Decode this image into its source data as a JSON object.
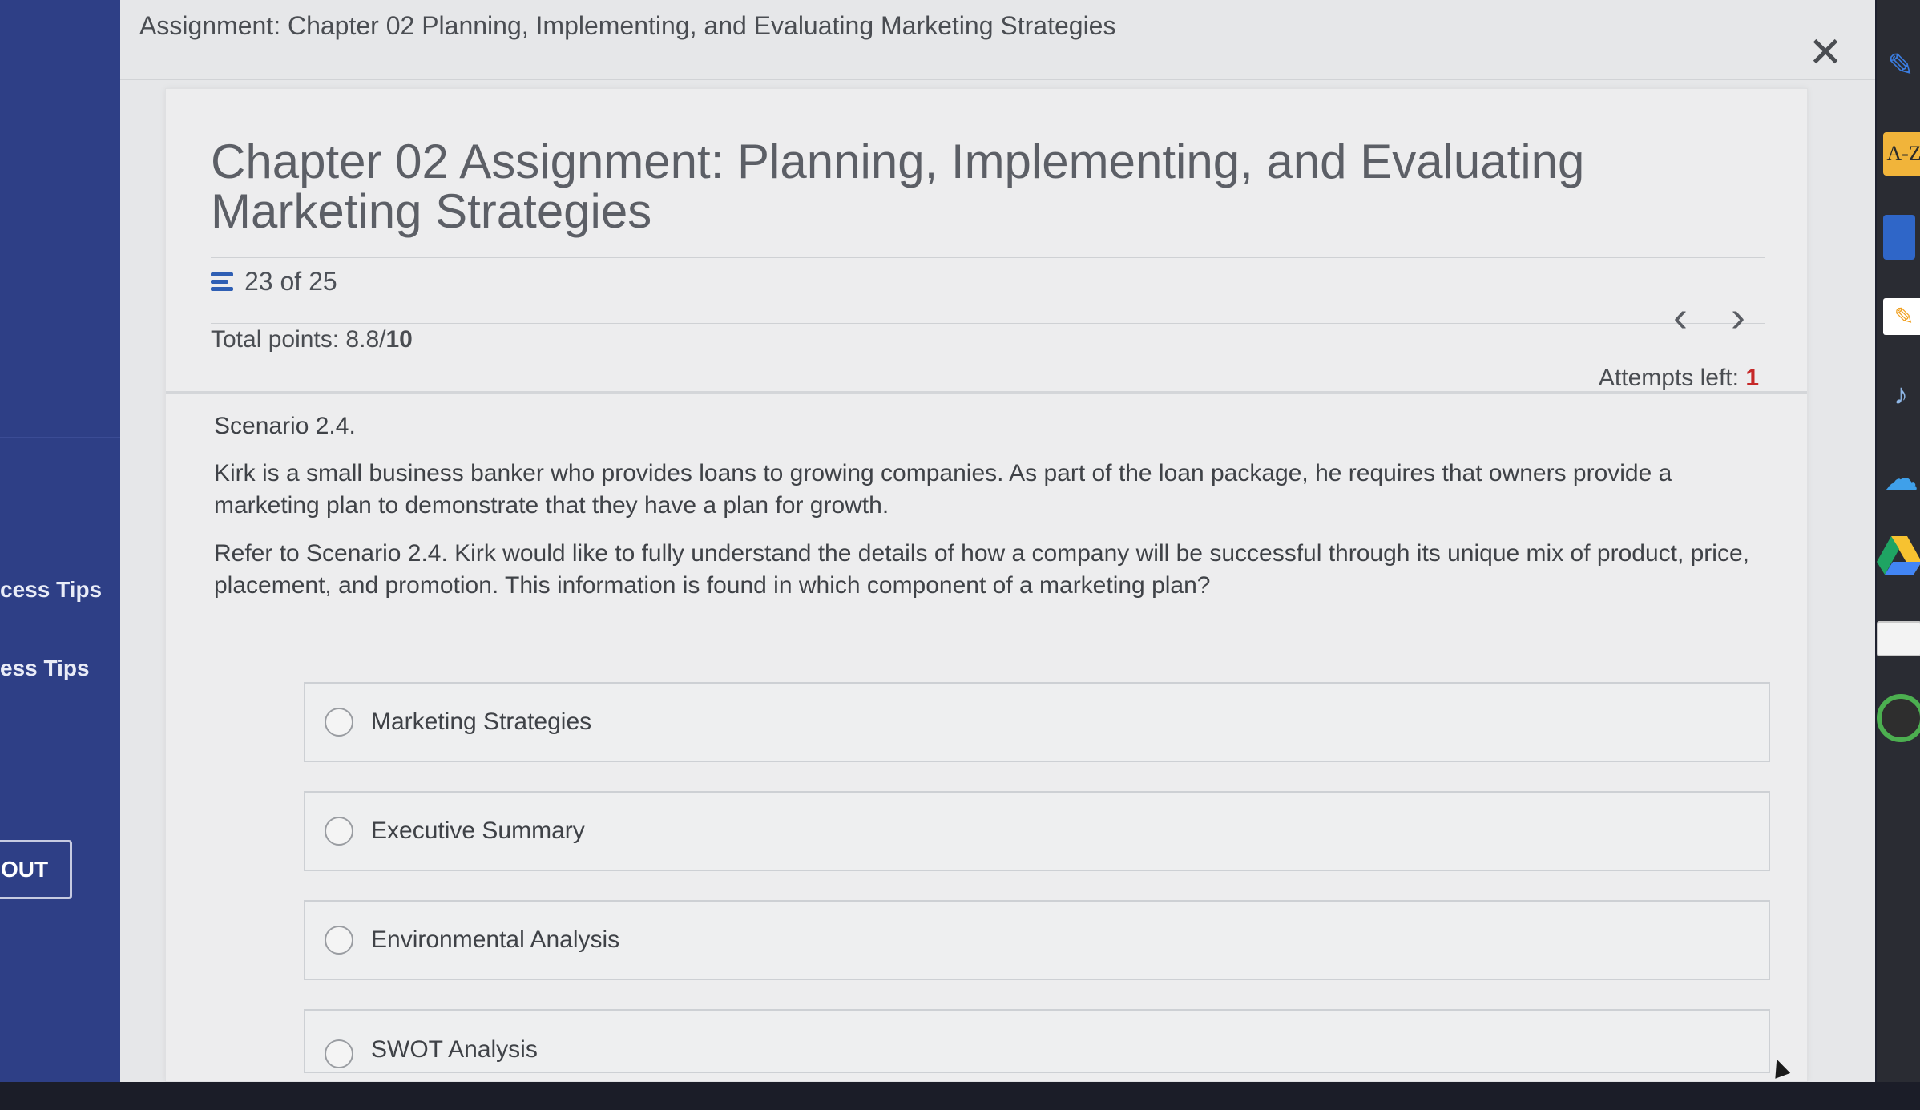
{
  "left_nav": {
    "item1": "cess Tips",
    "item2": "ess Tips",
    "logout_label": "OUT",
    "bg_color": "#2e3f86"
  },
  "modal": {
    "window_title": "Assignment: Chapter 02 Planning, Implementing, and Evaluating Marketing Strategies",
    "close_glyph": "✕"
  },
  "assignment": {
    "title": "Chapter 02 Assignment: Planning, Implementing, and Evaluating Marketing Strategies",
    "progress": "23 of 25",
    "points_label": "Total points: 8.8/",
    "points_total": "10",
    "prev_glyph": "‹",
    "next_glyph": "›",
    "attempts_label": "Attempts left: ",
    "attempts_value": "1",
    "attempts_color": "#c62828"
  },
  "question": {
    "scenario_label": "Scenario 2.4.",
    "scenario_text": "Kirk is a small business banker who provides loans to growing companies. As part of the loan package, he requires that owners provide a marketing plan to demonstrate that they have a plan for growth.",
    "prompt": "Refer to Scenario 2.4. Kirk would like to fully understand the details of how a company will be successful through its unique mix of product, price, placement, and promotion. This information is found in which component of a marketing plan?",
    "options": [
      {
        "label": "Marketing Strategies"
      },
      {
        "label": "Executive Summary"
      },
      {
        "label": "Environmental Analysis"
      },
      {
        "label": "SWOT Analysis"
      }
    ]
  },
  "toolbar": {
    "icons": [
      "pencil-icon",
      "dictionary-icon",
      "book-icon",
      "notepad-icon",
      "speech-icon",
      "onedrive-icon",
      "google-drive-icon",
      "notes-icon",
      "profile-icon"
    ],
    "az_label": "A-Z",
    "accent": "#2f5fb4"
  }
}
